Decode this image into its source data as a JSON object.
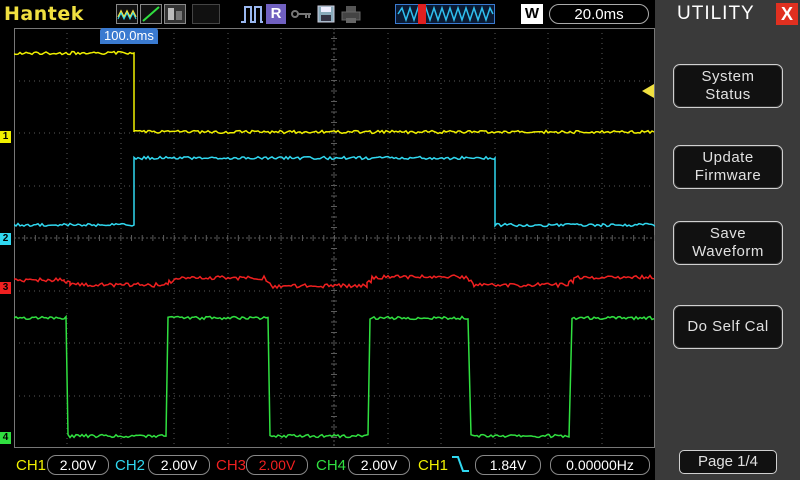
{
  "header": {
    "brand": "Hantek",
    "run_state": "R",
    "acq_mode": "W",
    "timebase": "20.0ms"
  },
  "cursor_label": "100.0ms",
  "channels": [
    {
      "marker": "1",
      "color": "#f0f000"
    },
    {
      "marker": "2",
      "color": "#30d8f0"
    },
    {
      "marker": "3",
      "color": "#f02020"
    },
    {
      "marker": "4",
      "color": "#30e040"
    }
  ],
  "status": {
    "ch1_label": "CH1",
    "ch1_scale": "2.00V",
    "ch2_label": "CH2",
    "ch2_scale": "2.00V",
    "ch3_label": "CH3",
    "ch3_scale": "2.00V",
    "ch4_label": "CH4",
    "ch4_scale": "2.00V",
    "trig_source": "CH1",
    "trig_level": "1.84V",
    "frequency": "0.00000Hz"
  },
  "menu": {
    "title": "UTILITY",
    "close": "X",
    "buttons": [
      "System\nStatus",
      "Update\nFirmware",
      "Save\nWaveform",
      "Do Self Cal"
    ],
    "page": "Page 1/4"
  },
  "colors": {
    "grid": "#5a5a5a",
    "side_panel": "#3a3a3a",
    "cursor_label_bg": "#3a7ad0"
  }
}
